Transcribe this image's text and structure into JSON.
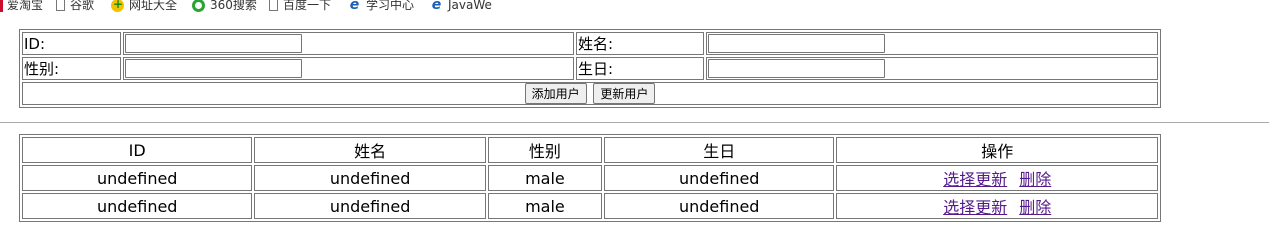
{
  "bookmarks": [
    {
      "label": "爱淘宝",
      "icon": "taobao-icon"
    },
    {
      "label": "谷歌",
      "icon": "page-icon"
    },
    {
      "label": "网址大全",
      "icon": "hao123-icon"
    },
    {
      "label": "360搜索",
      "icon": "360-search-icon"
    },
    {
      "label": "百度一下",
      "icon": "page-icon"
    },
    {
      "label": "学习中心",
      "icon": "ie-icon"
    },
    {
      "label": "JavaWe",
      "icon": "ie-icon"
    }
  ],
  "form": {
    "id_label": "ID:",
    "name_label": "姓名:",
    "gender_label": "性别:",
    "birthday_label": "生日:",
    "id_value": "",
    "name_value": "",
    "gender_value": "",
    "birthday_value": "",
    "add_button": "添加用户",
    "update_button": "更新用户"
  },
  "table": {
    "headers": [
      "ID",
      "姓名",
      "性别",
      "生日",
      "操作"
    ],
    "rows": [
      {
        "id": "undefined",
        "name": "undefined",
        "gender": "male",
        "birthday": "undefined",
        "select_update": "选择更新",
        "delete": "删除"
      },
      {
        "id": "undefined",
        "name": "undefined",
        "gender": "male",
        "birthday": "undefined",
        "select_update": "选择更新",
        "delete": "删除"
      }
    ]
  }
}
